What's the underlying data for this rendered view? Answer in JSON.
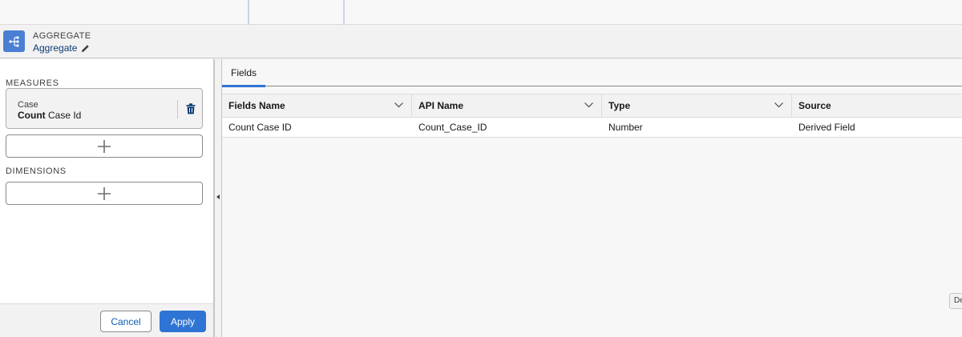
{
  "node": {
    "type_label": "AGGREGATE",
    "name": "Aggregate",
    "icon": "aggregate-icon",
    "accent_color": "#4a7fd3"
  },
  "left_panel": {
    "measures_label": "MEASURES",
    "measure": {
      "object": "Case",
      "function": "Count",
      "field": "Case Id"
    },
    "dimensions_label": "DIMENSIONS",
    "cancel_label": "Cancel",
    "apply_label": "Apply"
  },
  "right_panel": {
    "tabs": [
      {
        "label": "Fields",
        "active": true
      }
    ],
    "columns": [
      "Fields Name",
      "API Name",
      "Type",
      "Source"
    ],
    "rows": [
      [
        "Count Case ID",
        "Count_Case_ID",
        "Number",
        "Derived Field"
      ]
    ]
  },
  "edge_tooltip": "De",
  "colors": {
    "primary_button": "#2e74d4",
    "link": "#0b5cab"
  }
}
